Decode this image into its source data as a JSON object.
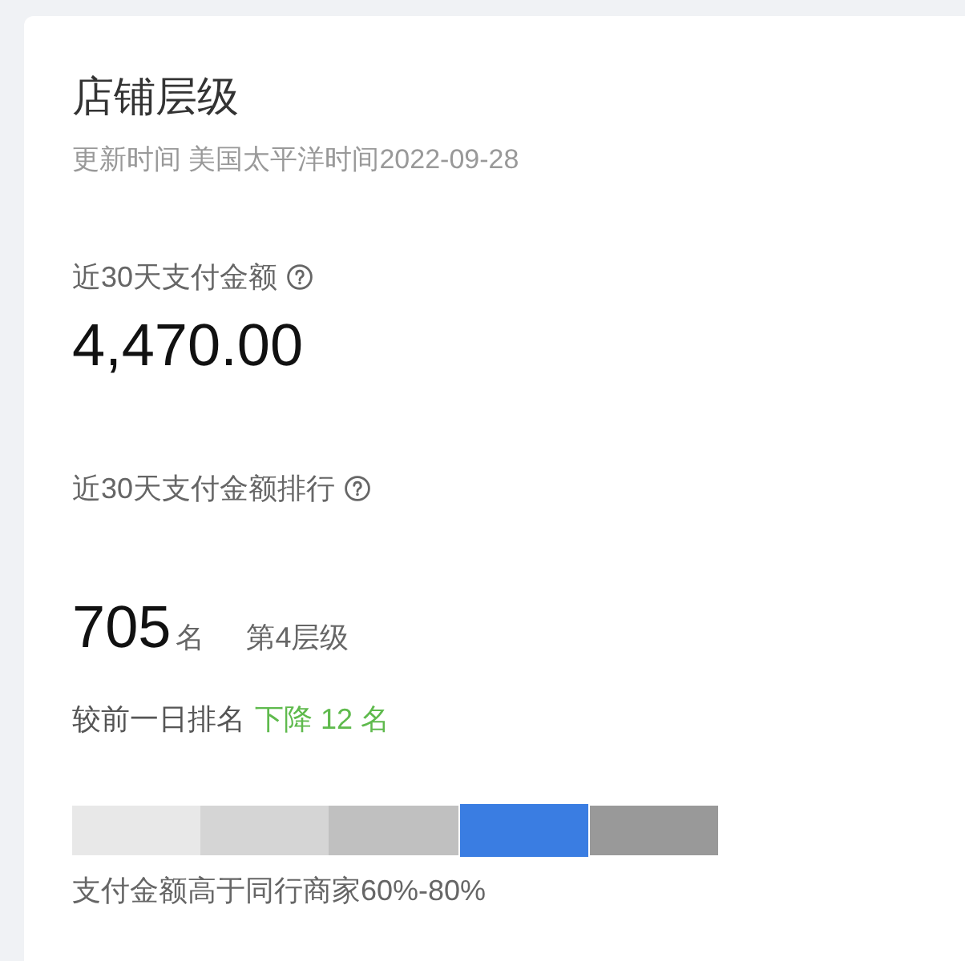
{
  "card": {
    "title": "店铺层级",
    "updated": "更新时间 美国太平洋时间2022-09-28"
  },
  "payment": {
    "label": "近30天支付金额",
    "value": "4,470.00"
  },
  "ranking": {
    "label": "近30天支付金额排行",
    "rank": "705",
    "rank_unit": "名",
    "tier": "第4层级",
    "change_label": "较前一日排名",
    "change": "下降 12 名"
  },
  "tiers": [
    {
      "color": "#e8e8e8",
      "selected": false
    },
    {
      "color": "#d5d5d5",
      "selected": false
    },
    {
      "color": "#c0c0c0",
      "selected": false
    },
    {
      "color": "#3a7de2",
      "selected": true
    },
    {
      "color": "#999999",
      "selected": false
    }
  ],
  "tier_caption": "支付金额高于同行商家60%-80%"
}
